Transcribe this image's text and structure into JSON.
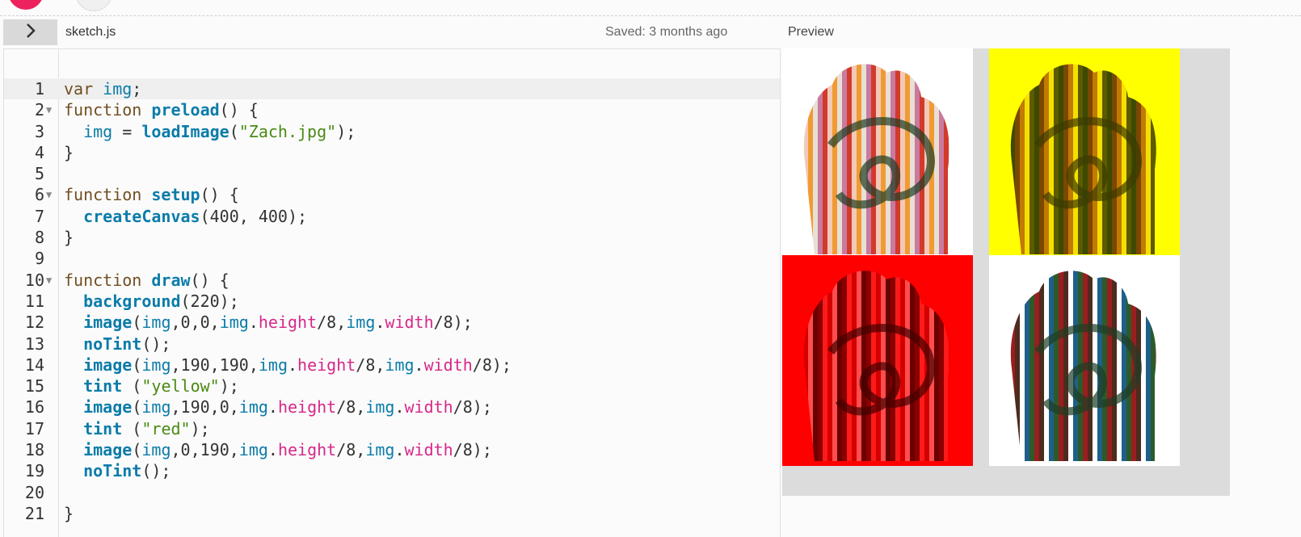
{
  "header": {
    "file_name": "sketch.js",
    "saved_status": "Saved: 3 months ago",
    "preview_title": "Preview"
  },
  "editor": {
    "lines": [
      {
        "n": "1",
        "fold": false,
        "tokens": [
          [
            "kw",
            "var "
          ],
          [
            "id",
            "img"
          ],
          [
            "plain",
            ";"
          ]
        ]
      },
      {
        "n": "2",
        "fold": true,
        "tokens": [
          [
            "kw",
            "function "
          ],
          [
            "fn",
            "preload"
          ],
          [
            "plain",
            "() {"
          ]
        ]
      },
      {
        "n": "3",
        "fold": false,
        "tokens": [
          [
            "plain",
            "  "
          ],
          [
            "id",
            "img"
          ],
          [
            "plain",
            " = "
          ],
          [
            "fn",
            "loadImage"
          ],
          [
            "plain",
            "("
          ],
          [
            "str",
            "\"Zach.jpg\""
          ],
          [
            "plain",
            ");"
          ]
        ]
      },
      {
        "n": "4",
        "fold": false,
        "tokens": [
          [
            "plain",
            "}"
          ]
        ]
      },
      {
        "n": "5",
        "fold": false,
        "tokens": []
      },
      {
        "n": "6",
        "fold": true,
        "tokens": [
          [
            "kw",
            "function "
          ],
          [
            "fn",
            "setup"
          ],
          [
            "plain",
            "() {"
          ]
        ]
      },
      {
        "n": "7",
        "fold": false,
        "tokens": [
          [
            "plain",
            "  "
          ],
          [
            "fn",
            "createCanvas"
          ],
          [
            "plain",
            "(400, 400);"
          ]
        ]
      },
      {
        "n": "8",
        "fold": false,
        "tokens": [
          [
            "plain",
            "}"
          ]
        ]
      },
      {
        "n": "9",
        "fold": false,
        "tokens": []
      },
      {
        "n": "10",
        "fold": true,
        "tokens": [
          [
            "kw",
            "function "
          ],
          [
            "fn",
            "draw"
          ],
          [
            "plain",
            "() {"
          ]
        ]
      },
      {
        "n": "11",
        "fold": false,
        "tokens": [
          [
            "plain",
            "  "
          ],
          [
            "fn",
            "background"
          ],
          [
            "plain",
            "(220);"
          ]
        ]
      },
      {
        "n": "12",
        "fold": false,
        "tokens": [
          [
            "plain",
            "  "
          ],
          [
            "fn",
            "image"
          ],
          [
            "plain",
            "("
          ],
          [
            "id",
            "img"
          ],
          [
            "plain",
            ",0,0,"
          ],
          [
            "id",
            "img"
          ],
          [
            "plain",
            "."
          ],
          [
            "prop",
            "height"
          ],
          [
            "plain",
            "/8,"
          ],
          [
            "id",
            "img"
          ],
          [
            "plain",
            "."
          ],
          [
            "prop",
            "width"
          ],
          [
            "plain",
            "/8);"
          ]
        ]
      },
      {
        "n": "13",
        "fold": false,
        "tokens": [
          [
            "plain",
            "  "
          ],
          [
            "fn",
            "noTint"
          ],
          [
            "plain",
            "();"
          ]
        ]
      },
      {
        "n": "14",
        "fold": false,
        "tokens": [
          [
            "plain",
            "  "
          ],
          [
            "fn",
            "image"
          ],
          [
            "plain",
            "("
          ],
          [
            "id",
            "img"
          ],
          [
            "plain",
            ",190,190,"
          ],
          [
            "id",
            "img"
          ],
          [
            "plain",
            "."
          ],
          [
            "prop",
            "height"
          ],
          [
            "plain",
            "/8,"
          ],
          [
            "id",
            "img"
          ],
          [
            "plain",
            "."
          ],
          [
            "prop",
            "width"
          ],
          [
            "plain",
            "/8);"
          ]
        ]
      },
      {
        "n": "15",
        "fold": false,
        "tokens": [
          [
            "plain",
            "  "
          ],
          [
            "fn",
            "tint"
          ],
          [
            "plain",
            " ("
          ],
          [
            "str",
            "\"yellow\""
          ],
          [
            "plain",
            ");"
          ]
        ]
      },
      {
        "n": "16",
        "fold": false,
        "tokens": [
          [
            "plain",
            "  "
          ],
          [
            "fn",
            "image"
          ],
          [
            "plain",
            "("
          ],
          [
            "id",
            "img"
          ],
          [
            "plain",
            ",190,0,"
          ],
          [
            "id",
            "img"
          ],
          [
            "plain",
            "."
          ],
          [
            "prop",
            "height"
          ],
          [
            "plain",
            "/8,"
          ],
          [
            "id",
            "img"
          ],
          [
            "plain",
            "."
          ],
          [
            "prop",
            "width"
          ],
          [
            "plain",
            "/8);"
          ]
        ]
      },
      {
        "n": "17",
        "fold": false,
        "tokens": [
          [
            "plain",
            "  "
          ],
          [
            "fn",
            "tint"
          ],
          [
            "plain",
            " ("
          ],
          [
            "str",
            "\"red\""
          ],
          [
            "plain",
            ");"
          ]
        ]
      },
      {
        "n": "18",
        "fold": false,
        "tokens": [
          [
            "plain",
            "  "
          ],
          [
            "fn",
            "image"
          ],
          [
            "plain",
            "("
          ],
          [
            "id",
            "img"
          ],
          [
            "plain",
            ",0,190,"
          ],
          [
            "id",
            "img"
          ],
          [
            "plain",
            "."
          ],
          [
            "prop",
            "height"
          ],
          [
            "plain",
            "/8,"
          ],
          [
            "id",
            "img"
          ],
          [
            "plain",
            "."
          ],
          [
            "prop",
            "width"
          ],
          [
            "plain",
            "/8);"
          ]
        ]
      },
      {
        "n": "19",
        "fold": false,
        "tokens": [
          [
            "plain",
            "  "
          ],
          [
            "fn",
            "noTint"
          ],
          [
            "plain",
            "();"
          ]
        ]
      },
      {
        "n": "20",
        "fold": false,
        "tokens": []
      },
      {
        "n": "21",
        "fold": false,
        "tokens": [
          [
            "plain",
            "}"
          ]
        ]
      }
    ]
  },
  "preview": {
    "canvas_background": "#dcdcdc",
    "tiles": [
      {
        "name": "top-left",
        "background": "#ffffff",
        "tint": "none"
      },
      {
        "name": "top-right",
        "background": "#ffff00",
        "tint": "yellow"
      },
      {
        "name": "bottom-left",
        "background": "#ff0000",
        "tint": "red"
      },
      {
        "name": "bottom-right",
        "background": "#ffffff",
        "tint": "none"
      }
    ]
  },
  "icons": {
    "sidebar_toggle": "chevron-right-icon",
    "play": "play-button",
    "stop": "stop-button"
  },
  "colors": {
    "accent": "#ed225d",
    "keyword": "#704f21",
    "function": "#0b7ca9",
    "property": "#d52889",
    "string": "#4a8a14"
  }
}
